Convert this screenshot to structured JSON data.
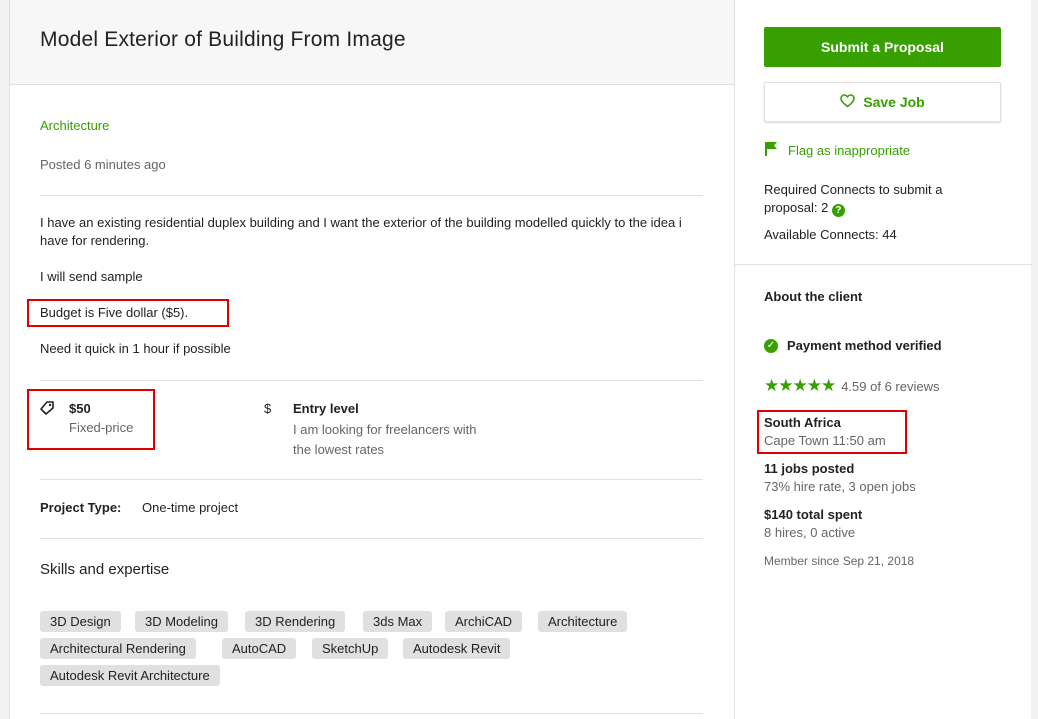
{
  "job": {
    "title": "Model Exterior of Building From Image",
    "category": "Architecture",
    "posted": "Posted 6 minutes ago",
    "description": [
      "I have an existing residential duplex building and I want the exterior of the building modelled quickly to the idea i have for rendering.",
      "I will send sample",
      "Budget is Five dollar ($5).",
      "Need it quick in 1 hour if possible"
    ],
    "price": {
      "value": "$50",
      "type": "Fixed-price"
    },
    "level": {
      "title": "Entry level",
      "desc": "I am looking for freelancers with the lowest rates"
    },
    "project_type": {
      "label": "Project Type:",
      "value": "One-time project"
    },
    "skills_title": "Skills and expertise",
    "skills": [
      "3D Design",
      "3D Modeling",
      "3D Rendering",
      "3ds Max",
      "ArchiCAD",
      "Architecture",
      "Architectural Rendering",
      "AutoCAD",
      "SketchUp",
      "Autodesk Revit",
      "Autodesk Revit Architecture"
    ]
  },
  "sidebar": {
    "submit_label": "Submit a Proposal",
    "save_label": "Save Job",
    "flag_label": "Flag as inappropriate",
    "connects_required": "Required Connects to submit a proposal: 2",
    "connects_available": "Available Connects: 44"
  },
  "client": {
    "heading": "About the client",
    "payment": "Payment method verified",
    "rating": 4.59,
    "reviews": "4.59 of 6 reviews",
    "country": "South Africa",
    "city_time": "Cape Town 11:50 am",
    "jobs_posted": "11 jobs posted",
    "hire_rate": "73% hire rate, 3 open jobs",
    "total_spent": "$140 total spent",
    "hires": "8 hires, 0 active",
    "member_since": "Member since Sep 21, 2018"
  },
  "colors": {
    "accent": "#37a000",
    "highlight": "#e00000"
  }
}
